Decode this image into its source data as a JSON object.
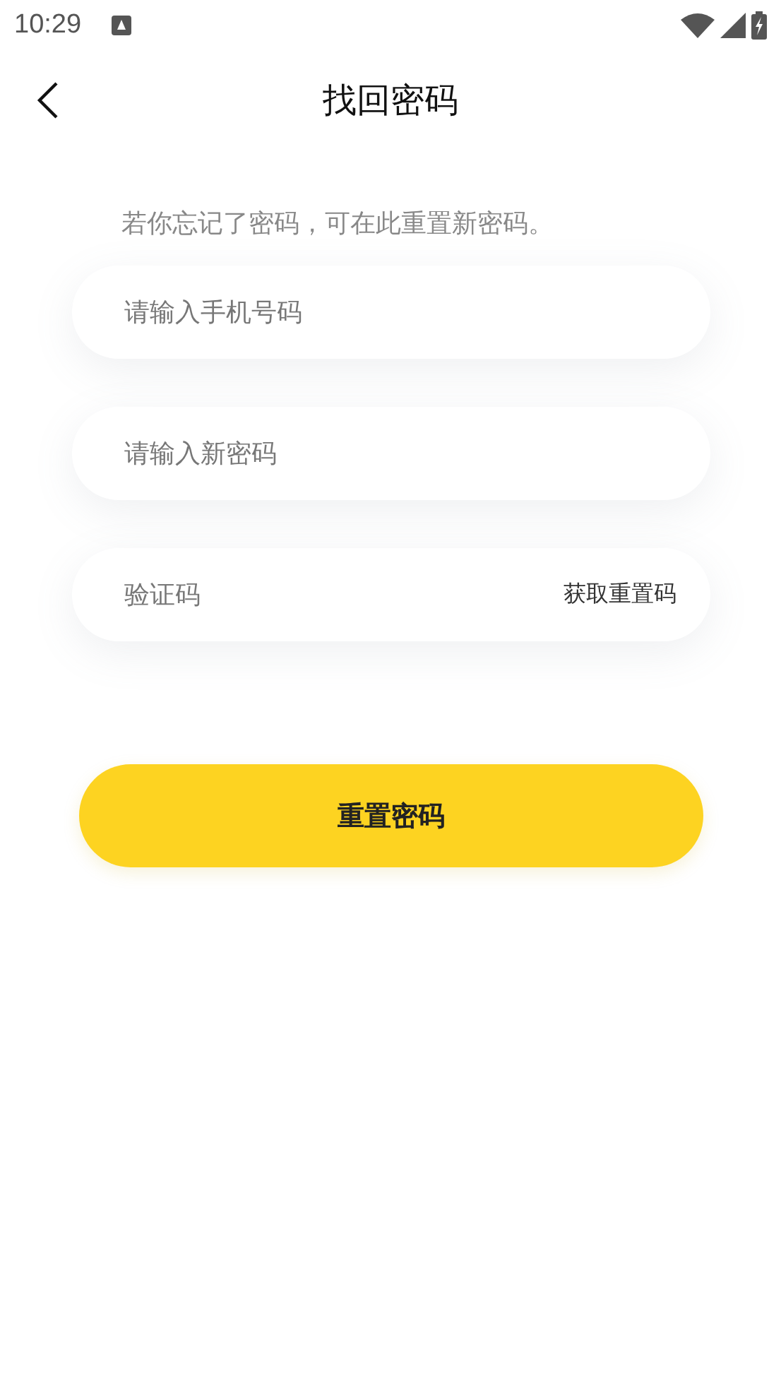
{
  "status_bar": {
    "time": "10:29"
  },
  "header": {
    "title": "找回密码"
  },
  "hint": "若你忘记了密码，可在此重置新密码。",
  "fields": [
    {
      "kind": "text",
      "placeholder": "请输入手机号码"
    },
    {
      "kind": "text",
      "placeholder": "请输入新密码"
    },
    {
      "kind": "code",
      "placeholder": "验证码",
      "action": "获取重置码"
    }
  ],
  "submit_button": "重置密码"
}
